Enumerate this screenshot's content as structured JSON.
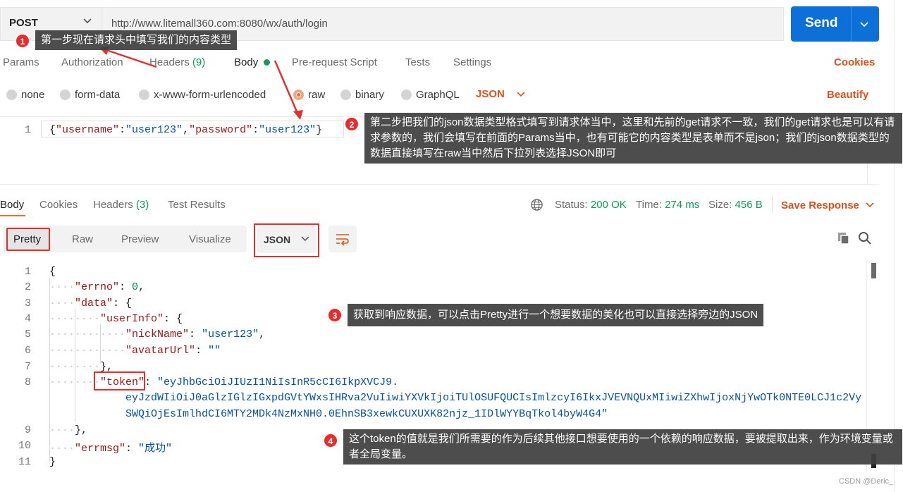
{
  "request": {
    "method": "POST",
    "url": "http://www.litemall360.com:8080/wx/auth/login",
    "send_label": "Send",
    "tabs": [
      "Params",
      "Authorization",
      "Headers",
      "Body",
      "Pre-request Script",
      "Tests",
      "Settings"
    ],
    "headers_count": "(9)",
    "cookies_label": "Cookies",
    "body_types": [
      "none",
      "form-data",
      "x-www-form-urlencoded",
      "raw",
      "binary",
      "GraphQL"
    ],
    "selected_body_type": "raw",
    "raw_format": "JSON",
    "beautify_label": "Beautify",
    "line_number": "1",
    "body_json": {
      "k1": "\"username\"",
      "v1": "\"user123\"",
      "k2": "\"password\"",
      "v2": "\"user123\""
    }
  },
  "response": {
    "tabs": [
      "Body",
      "Cookies",
      "Headers",
      "Test Results"
    ],
    "headers_count": "(3)",
    "status_label": "Status:",
    "status_value": "200 OK",
    "time_label": "Time:",
    "time_value": "274 ms",
    "size_label": "Size:",
    "size_value": "456 B",
    "save_label": "Save Response",
    "view_modes": [
      "Pretty",
      "Raw",
      "Preview",
      "Visualize"
    ],
    "selected_view": "Pretty",
    "format": "JSON",
    "line_numbers": [
      "1",
      "2",
      "3",
      "4",
      "5",
      "6",
      "7",
      "8",
      "",
      "",
      "9",
      "10",
      "11"
    ],
    "json": {
      "errno_key": "\"errno\"",
      "errno_val": "0",
      "data_key": "\"data\"",
      "userinfo_key": "\"userInfo\"",
      "nickname_key": "\"nickName\"",
      "nickname_val": "\"user123\"",
      "avatar_key": "\"avatarUrl\"",
      "avatar_val": "\"\"",
      "token_key": "\"token\"",
      "token_line1": "\"eyJhbGciOiJIUzI1NiIsInR5cCI6IkpXVCJ9.",
      "token_line2": "eyJzdWIiOiJ0aGlzIGlzIGxpdGVtYWxsIHRva2VuIiwiYXVkIjoiTUlOSUFQUCIsImlzcyI6IkxJVEVNQUxMIiwiZXhwIjoxNjYwOTk0NTE0LCJ1c2Vy",
      "token_line3": "SWQiOjEsImlhdCI6MTY2MDk4NzMxNH0.0EhnSB3xewkCUXUXK82njz_1IDlWYYBqTkol4byW4G4\"",
      "errmsg_key": "\"errmsg\"",
      "errmsg_val": "\"成功\""
    }
  },
  "annotations": [
    {
      "badge": "1",
      "text": "第一步现在请求头中填写我们的内容类型"
    },
    {
      "badge": "2",
      "text": "第二步把我们的json数据类型格式填写到请求体当中，这里和先前的get请求不一致，我们的get请求也是可以有请求参数的，我们会填写在前面的Params当中，也有可能它的内容类型是表单而不是json；我们的json数据类型的数据直接填写在raw当中然后下拉列表选择JSON即可"
    },
    {
      "badge": "3",
      "text": "获取到响应数据，可以点击Pretty进行一个想要数据的美化也可以直接选择旁边的JSON"
    },
    {
      "badge": "4",
      "text": "这个token的值就是我们所需要的作为后续其他接口想要使用的一个依赖的响应数据，要被提取出来，作为环境变量或者全局变量。"
    }
  ],
  "watermark": "CSDN @Deric_",
  "colors": {
    "accent": "#d9531e",
    "send": "#0d6fd8",
    "annotation_badge": "#e82b2b",
    "highlight_box": "#e0312f",
    "status_ok": "#0f9d58"
  }
}
